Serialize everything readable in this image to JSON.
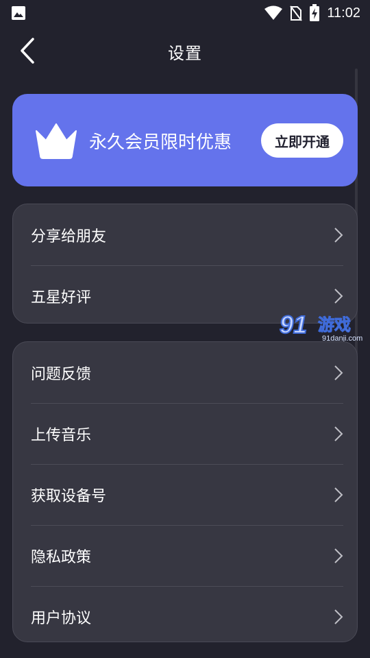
{
  "status_bar": {
    "time": "11:02",
    "icons": [
      "image-icon",
      "wifi-icon",
      "no-sim-icon",
      "battery-charging-icon"
    ]
  },
  "header": {
    "title": "设置",
    "back_icon": "chevron-left-icon"
  },
  "vip_banner": {
    "icon": "crown-icon",
    "text": "永久会员限时优惠",
    "button_label": "立即开通",
    "background": "#6473ec"
  },
  "groups": [
    {
      "items": [
        {
          "label": "分享给朋友",
          "icon": "chevron-right-icon"
        },
        {
          "label": "五星好评",
          "icon": "chevron-right-icon"
        }
      ]
    },
    {
      "items": [
        {
          "label": "问题反馈",
          "icon": "chevron-right-icon"
        },
        {
          "label": "上传音乐",
          "icon": "chevron-right-icon"
        },
        {
          "label": "获取设备号",
          "icon": "chevron-right-icon"
        },
        {
          "label": "隐私政策",
          "icon": "chevron-right-icon"
        },
        {
          "label": "用户协议",
          "icon": "chevron-right-icon"
        }
      ]
    }
  ],
  "watermark": {
    "sub_text": "91danji.com"
  },
  "colors": {
    "background": "#22222d",
    "card": "#373742",
    "accent": "#6473ec"
  }
}
